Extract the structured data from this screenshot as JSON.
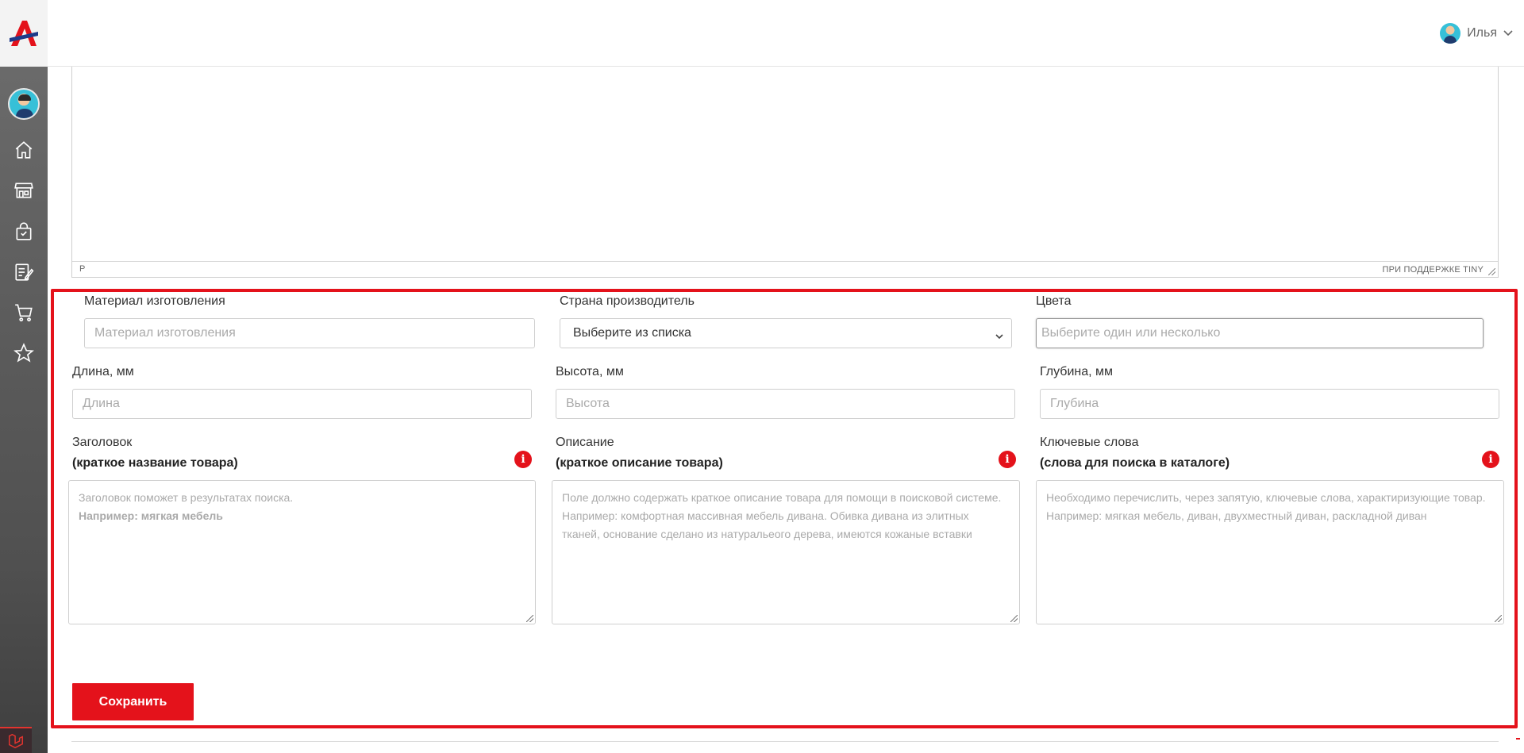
{
  "user": {
    "name": "Илья"
  },
  "sidebar": {
    "items": [
      {
        "icon": "home-icon"
      },
      {
        "icon": "store-icon"
      },
      {
        "icon": "shopping-bag-icon"
      },
      {
        "icon": "edit-document-icon"
      },
      {
        "icon": "cart-icon"
      },
      {
        "icon": "star-icon"
      }
    ]
  },
  "editor": {
    "path": "P",
    "brand": "ПРИ ПОДДЕРЖКЕ TINY"
  },
  "form": {
    "material": {
      "label": "Материал изготовления",
      "placeholder": "Материал изготовления"
    },
    "country": {
      "label": "Страна производитель",
      "value": "Выберите из списка"
    },
    "colors": {
      "label": "Цвета",
      "placeholder": "Выберите один или несколько"
    },
    "length": {
      "label": "Длина, мм",
      "placeholder": "Длина"
    },
    "height": {
      "label": "Высота, мм",
      "placeholder": "Высота"
    },
    "depth": {
      "label": "Глубина, мм",
      "placeholder": "Глубина"
    },
    "title": {
      "label": "Заголовок",
      "sublabel": "(краткое название товара)",
      "hint_line1": "Заголовок поможет в результатах поиска.",
      "hint_example": "Например: мягкая мебель"
    },
    "description": {
      "label": "Описание",
      "sublabel": "(краткое описание товара)",
      "hint_line1": "Поле должно содержать краткое описание товара для помощи в поисковой системе.",
      "hint_example": "Например: комфортная массивная мебель дивана. Обивка дивана из элитных тканей, основание сделано из натуральеого дерева, имеются кожаные вставки"
    },
    "keywords": {
      "label": "Ключевые слова",
      "sublabel": "(слова для поиска в каталоге)",
      "hint_line1": "Необходимо перечислить, через запятую, ключевые слова, характиризующие товар.",
      "hint_example": "Например: мягкая мебель, диван, двухместный диван, раскладной диван"
    },
    "save_label": "Сохранить"
  },
  "colors": {
    "accent": "#e4121b",
    "sidebar": "#5d5d5d"
  }
}
